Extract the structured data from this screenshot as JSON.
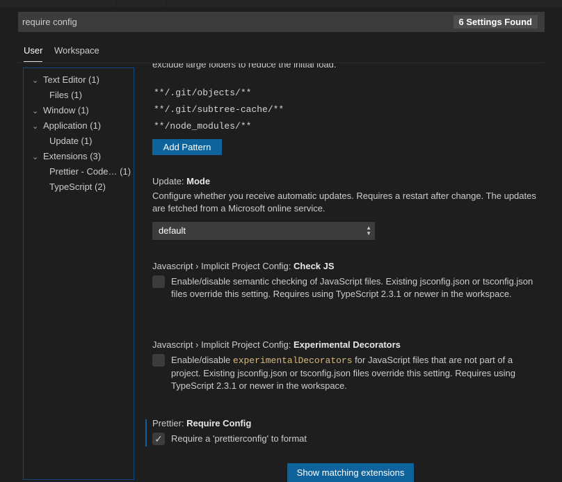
{
  "search": {
    "value": "require config",
    "results_badge": "6 Settings Found"
  },
  "tabs": [
    {
      "label": "User",
      "active": true
    },
    {
      "label": "Workspace",
      "active": false
    }
  ],
  "toc": [
    {
      "label": "Text Editor",
      "count": "(1)",
      "level": 0
    },
    {
      "label": "Files",
      "count": "(1)",
      "level": 1
    },
    {
      "label": "Window",
      "count": "(1)",
      "level": 0
    },
    {
      "label": "Application",
      "count": "(1)",
      "level": 0
    },
    {
      "label": "Update",
      "count": "(1)",
      "level": 1
    },
    {
      "label": "Extensions",
      "count": "(3)",
      "level": 0
    },
    {
      "label": "Prettier - Code…",
      "count": "(1)",
      "level": 1
    },
    {
      "label": "TypeScript",
      "count": "(2)",
      "level": 1
    }
  ],
  "exclude_section": {
    "description_cut": "exclude large folders to reduce the initial load.",
    "patterns": [
      "**/.git/objects/**",
      "**/.git/subtree-cache/**",
      "**/node_modules/**"
    ],
    "add_button": "Add Pattern"
  },
  "update_mode": {
    "category": "Update: ",
    "name": "Mode",
    "description": "Configure whether you receive automatic updates. Requires a restart after change. The updates are fetched from a Microsoft online service.",
    "value": "default"
  },
  "check_js": {
    "category": "Javascript › Implicit Project Config: ",
    "name": "Check JS",
    "description": "Enable/disable semantic checking of JavaScript files. Existing jsconfig.json or tsconfig.json files override this setting. Requires using TypeScript 2.3.1 or newer in the workspace.",
    "checked": false
  },
  "experimental_decorators": {
    "category": "Javascript › Implicit Project Config: ",
    "name": "Experimental Decorators",
    "desc_before": "Enable/disable ",
    "desc_code": "experimentalDecorators",
    "desc_after": " for JavaScript files that are not part of a project. Existing jsconfig.json or tsconfig.json files override this setting. Requires using TypeScript 2.3.1 or newer in the workspace.",
    "checked": false
  },
  "prettier_require_config": {
    "category": "Prettier: ",
    "name": "Require Config",
    "description": "Require a 'prettierconfig' to format",
    "checked": true,
    "check_glyph": "✓"
  },
  "show_extensions_button": "Show matching extensions",
  "colors": {
    "accent": "#0e639c",
    "background": "#1e1e1e",
    "input": "#3c3c3c",
    "code": "#d7ba7d"
  }
}
